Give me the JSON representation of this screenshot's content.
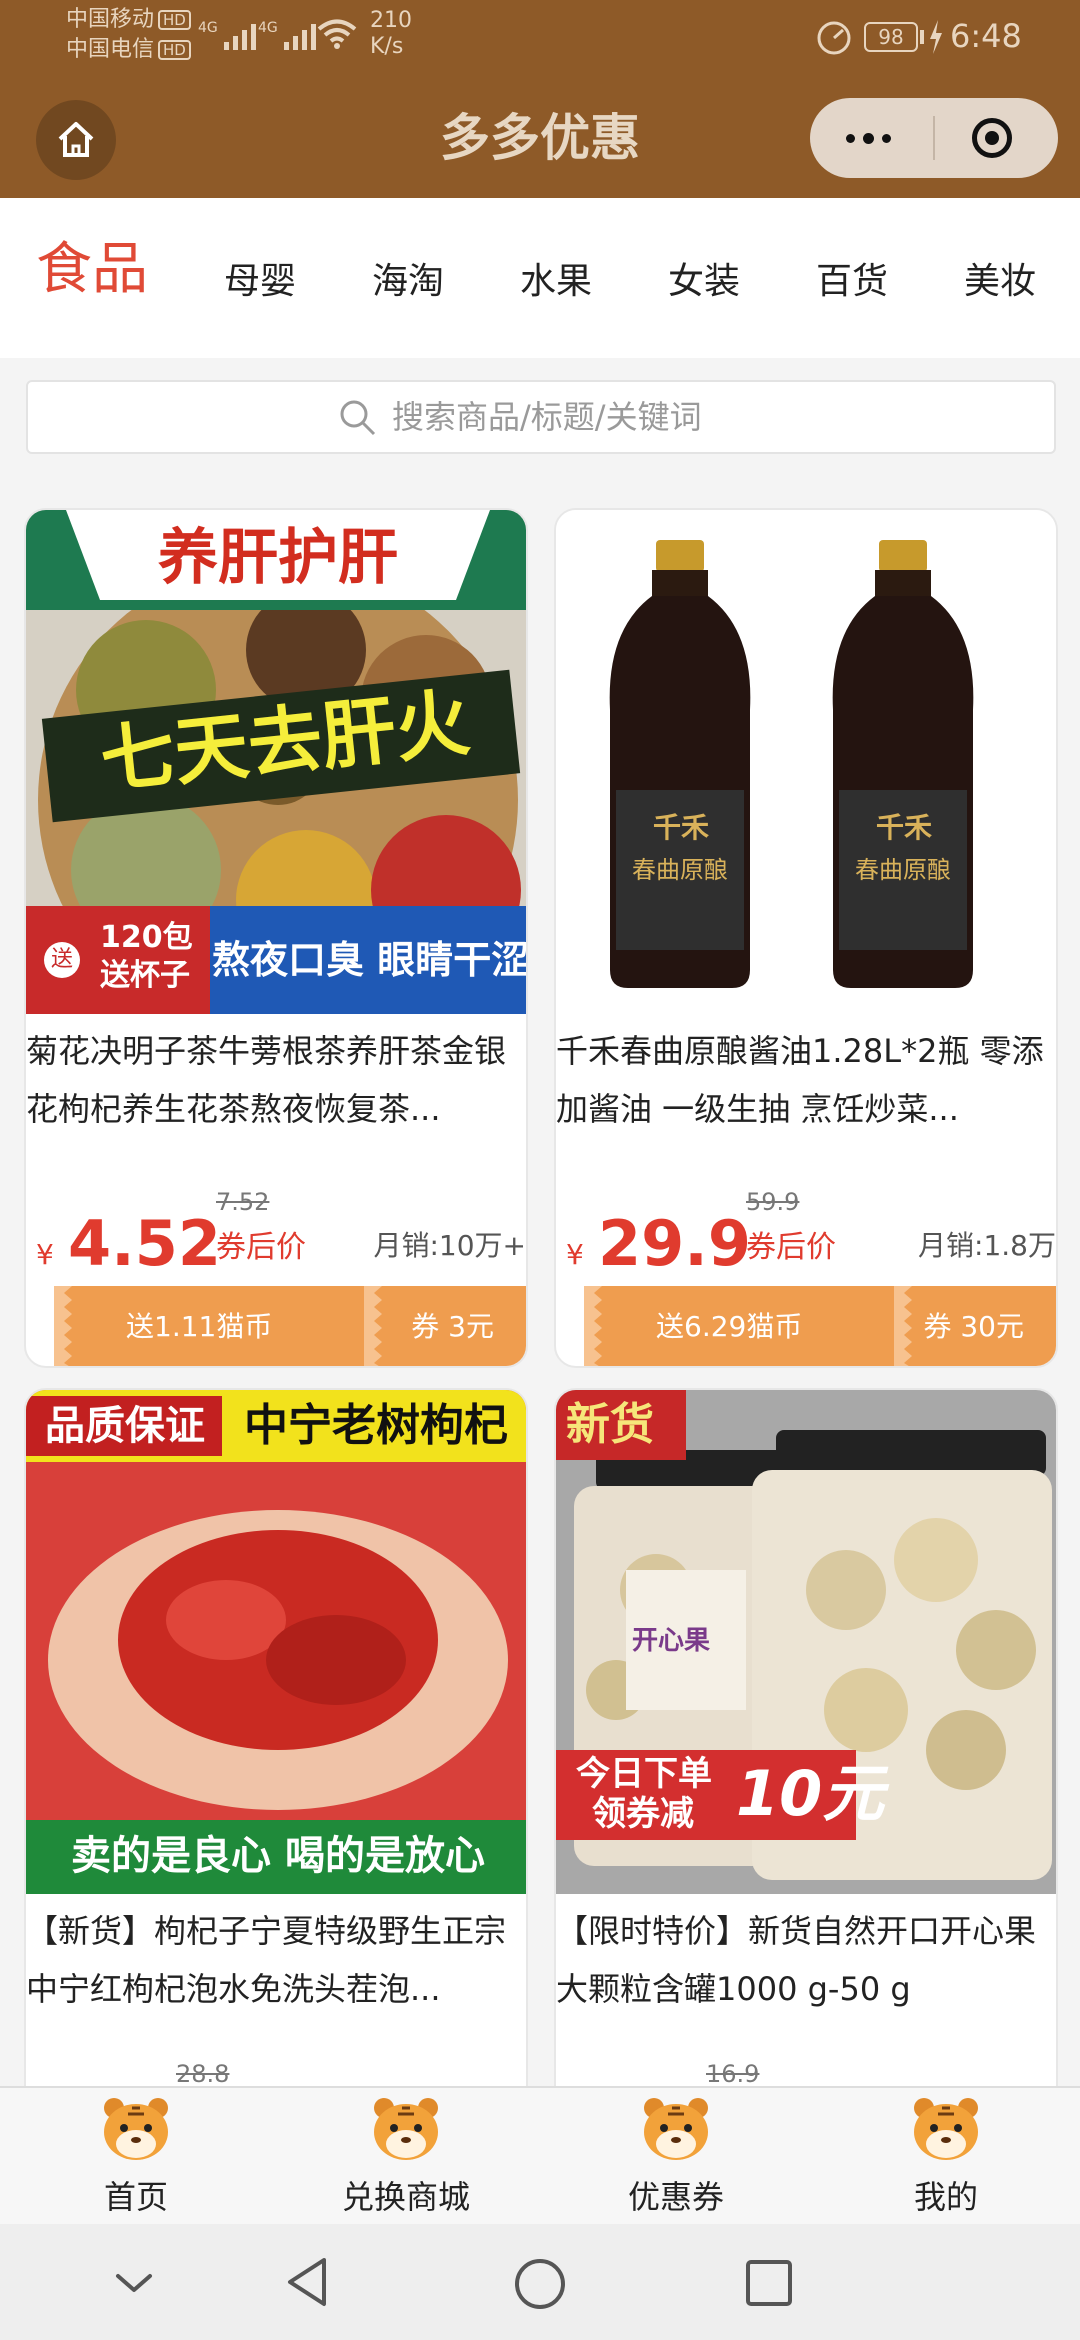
{
  "status_bar": {
    "carrier1": "中国移动",
    "carrier2": "中国电信",
    "hd": "HD",
    "net_speed": "210",
    "net_unit": "K/s",
    "battery": "98",
    "time": "6:48"
  },
  "header": {
    "title": "多多优惠"
  },
  "categories": [
    "食品",
    "母婴",
    "海淘",
    "水果",
    "女装",
    "百货",
    "美妆"
  ],
  "search": {
    "placeholder": "搜索商品/标题/关键词"
  },
  "products": [
    {
      "title": "菊花决明子茶牛蒡根茶养肝茶金银花枸杞养生花茶熬夜恢复茶...",
      "original_price": "7.52",
      "price": "4.52",
      "currency": "¥",
      "after_label": "券后价",
      "sales": "月销:10万+",
      "gift": "送1.11猫币",
      "coupon": "券 3元",
      "image_text": [
        "养肝护肝",
        "七天去肝火",
        "送",
        "120包",
        "送杯子",
        "熬夜口臭 眼睛干涩"
      ]
    },
    {
      "title": "千禾春曲原酿酱油1.28L*2瓶 零添加酱油 一级生抽 烹饪炒菜...",
      "original_price": "59.9",
      "price": "29.9",
      "currency": "¥",
      "after_label": "券后价",
      "sales": "月销:1.8万",
      "gift": "送6.29猫币",
      "coupon": "券 30元",
      "image_text": [
        "千禾",
        "春曲原酿",
        "千禾",
        "春曲原酿"
      ]
    },
    {
      "title": "【新货】枸杞子宁夏特级野生正宗中宁红枸杞泡水免洗头茬泡...",
      "original_price": "28.8",
      "image_text": [
        "品质保证",
        "中宁老树枸杞",
        "卖的是良心 喝的是放心"
      ]
    },
    {
      "title": "【限时特价】新货自然开口开心果大颗粒含罐1000 g-50 g",
      "original_price": "16.9",
      "image_text": [
        "新货",
        "开心果",
        "今日下单",
        "领券减",
        "10元"
      ]
    }
  ],
  "bottom_nav": [
    "首页",
    "兑换商城",
    "优惠券",
    "我的"
  ],
  "colors": {
    "brand_brown": "#8e5a28",
    "accent_red": "#e03b2e",
    "coupon_orange": "#ef9d4f"
  }
}
